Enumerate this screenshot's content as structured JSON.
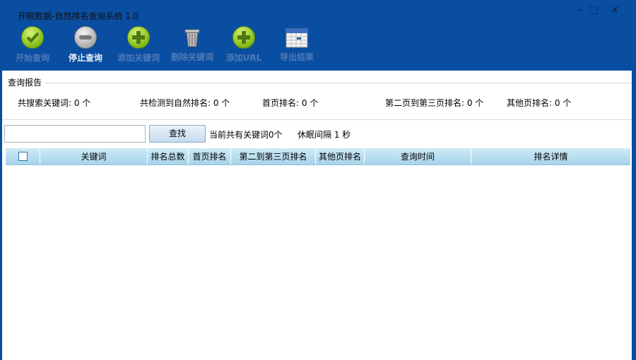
{
  "window": {
    "title": "开眼数据-自然排名查询系统 1.0",
    "minimize": "–",
    "maximize": "□",
    "close": "×"
  },
  "toolbar": [
    {
      "label": "开始查询",
      "icon": "check-icon"
    },
    {
      "label": "停止查询",
      "icon": "minus-icon"
    },
    {
      "label": "添加关键词",
      "icon": "plus-icon"
    },
    {
      "label": "删除关键词",
      "icon": "trash-icon"
    },
    {
      "label": "添加URL",
      "icon": "plus-icon"
    },
    {
      "label": "导出结果",
      "icon": "calendar-icon"
    }
  ],
  "report": {
    "title": "查询报告",
    "stats": [
      "共搜索关键词: 0 个",
      "共检测到自然排名: 0 个",
      "首页排名: 0 个",
      "第二页到第三页排名: 0 个",
      "其他页排名: 0 个"
    ]
  },
  "search": {
    "value": "",
    "button": "查找",
    "count_text": "当前共有关键词0个",
    "sleep_text": "休眠间隔 1 秒"
  },
  "table": {
    "columns": [
      "关键词",
      "排名总数",
      "首页排名",
      "第二到第三页排名",
      "其他页排名",
      "查询时间",
      "排名详情"
    ],
    "rows": []
  }
}
